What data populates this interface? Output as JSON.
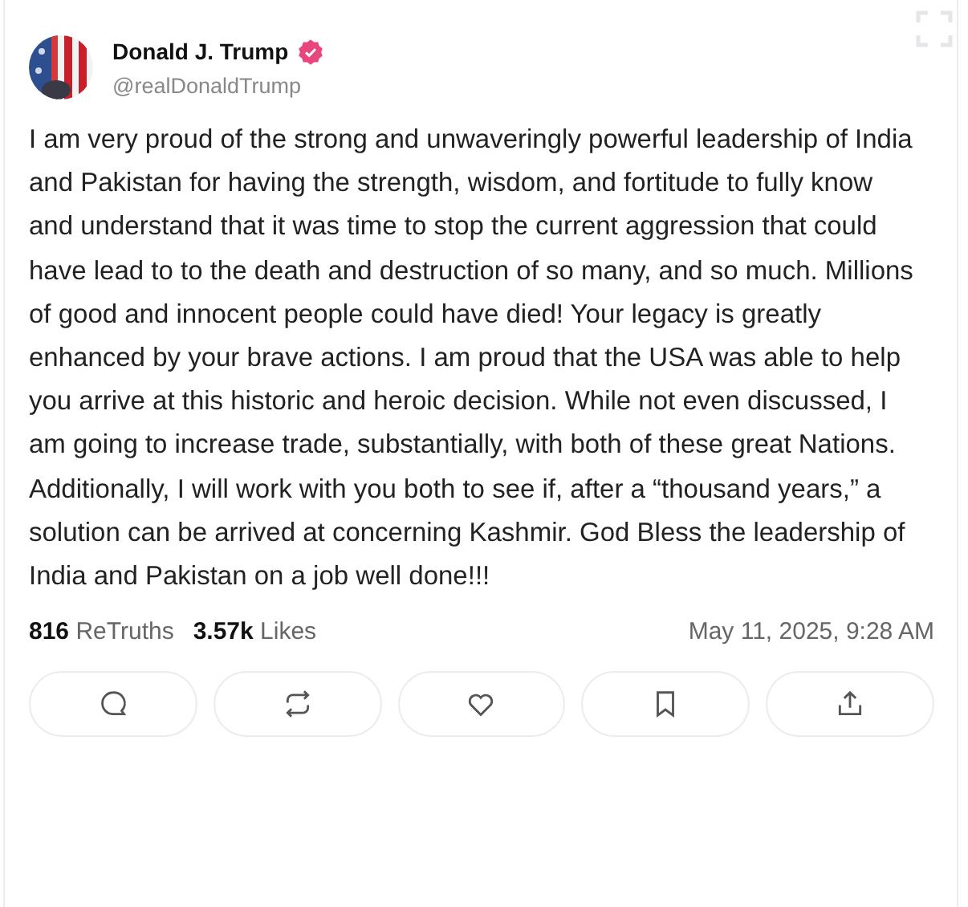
{
  "post": {
    "author": {
      "name": "Donald J. Trump",
      "verified": true,
      "handle": "@realDonaldTrump"
    },
    "text": "I am very proud of the strong and unwaveringly powerful leadership of India and Pakistan for having the strength, wisdom, and fortitude to fully know and understand that it was time to stop the current aggression that could have lead to to the death and destruction of so many, and so much. Millions of good and innocent people could have died! Your legacy is greatly enhanced by your brave actions. I am proud that the USA was able to help you arrive at this historic and heroic decision. While not even discussed, I am going to increase trade, substantially, with both of these great Nations. Additionally, I will work with you both to see if, after a “thousand years,” a solution can be arrived at concerning Kashmir. God Bless the leadership of India and Pakistan on a job well done!!!",
    "stats": [
      "**816** ReTruths",
      "**3.57k** Likes"
    ],
    "timestamp": "May 11, 2025, 9:28 AM",
    "actions": [
      {
        "kind": "reply"
      },
      {
        "kind": "repost"
      },
      {
        "kind": "like"
      },
      {
        "kind": "bookmark"
      },
      {
        "kind": "share"
      }
    ]
  }
}
